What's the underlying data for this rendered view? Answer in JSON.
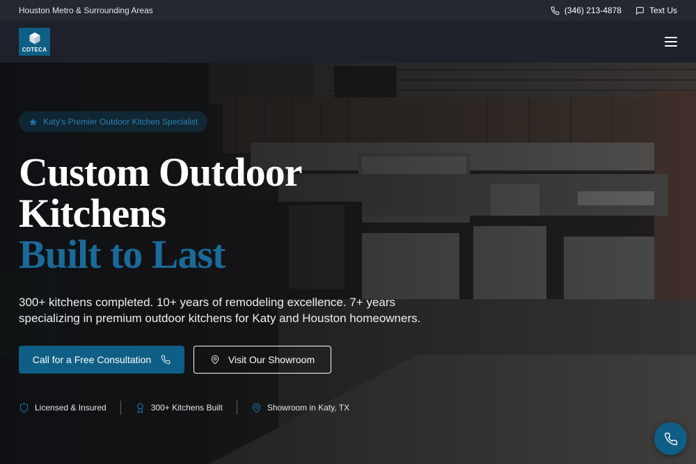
{
  "topbar": {
    "service_area": "Houston Metro & Surrounding Areas",
    "phone": "(346) 213-4878",
    "text_us": "Text Us"
  },
  "navbar": {
    "logo_text": "COTECA",
    "menu_icon": "hamburger-menu-icon"
  },
  "hero": {
    "badge": "Katy's Premier Outdoor Kitchen Specialist",
    "headline_line1": "Custom Outdoor",
    "headline_line2": "Kitchens",
    "headline_accent": "Built to Last",
    "subtext": "300+ kitchens completed. 10+ years of remodeling excellence. 7+ years specializing in premium outdoor kitchens for Katy and Houston homeowners.",
    "primary_cta": "Call for a Free Consultation",
    "secondary_cta": "Visit Our Showroom",
    "features": [
      {
        "label": "Licensed & Insured",
        "icon": "shield-icon"
      },
      {
        "label": "300+ Kitchens Built",
        "icon": "award-icon"
      },
      {
        "label": "Showroom in Katy, TX",
        "icon": "map-pin-icon"
      }
    ]
  },
  "colors": {
    "brand": "#0f5e86",
    "accent_text": "#1a6b9a",
    "topbar_bg": "#232831",
    "navbar_bg": "#1d2129"
  }
}
